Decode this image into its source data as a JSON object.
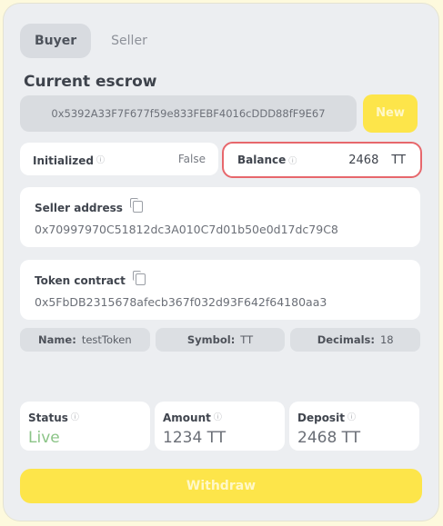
{
  "tabs": [
    {
      "label": "Buyer",
      "active": true
    },
    {
      "label": "Seller",
      "active": false
    }
  ],
  "escrow": {
    "title": "Current escrow",
    "address": "0x5392A33F7F677f59e833FEBF4016cDDD88fF9E67",
    "new_label": "New"
  },
  "initialized": {
    "label": "Initialized",
    "value": "False"
  },
  "balance": {
    "label": "Balance",
    "amount": "2468",
    "symbol": "TT"
  },
  "seller": {
    "label": "Seller address",
    "value": "0x70997970C51812dc3A010C7d01b50e0d17dc79C8"
  },
  "token": {
    "label": "Token contract",
    "value": "0x5FbDB2315678afecb367f032d93F642f64180aa3",
    "name_label": "Name:",
    "name_value": "testToken",
    "symbol_label": "Symbol:",
    "symbol_value": "TT",
    "decimals_label": "Decimals:",
    "decimals_value": "18"
  },
  "status": {
    "label": "Status",
    "value": "Live"
  },
  "amount": {
    "label": "Amount",
    "value": "1234 TT"
  },
  "deposit": {
    "label": "Deposit",
    "value": "2468 TT"
  },
  "withdraw_label": "Withdraw",
  "colors": {
    "accent": "#fde54a",
    "highlight_border": "#e7676c",
    "live": "#8bc487"
  },
  "icons": {
    "help": "question-circle-icon",
    "copy": "copy-icon"
  }
}
